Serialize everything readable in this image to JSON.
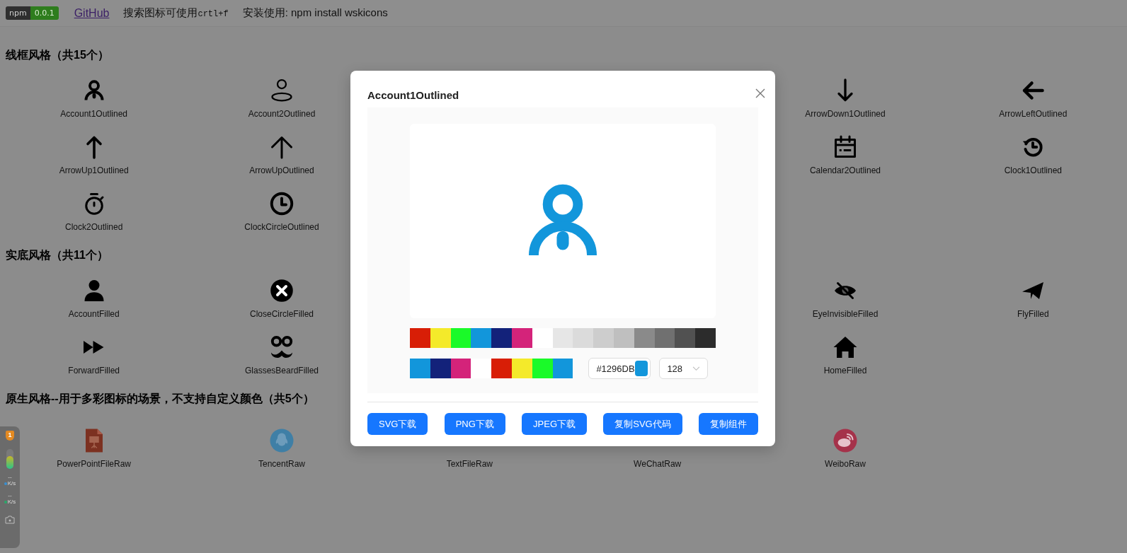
{
  "top_bar": {
    "badge": {
      "label": "npm",
      "version": "0.0.1"
    },
    "github_link": "GitHub",
    "search_hint": {
      "text": "搜索图标可使用",
      "shortcut": "crtl+f"
    },
    "install_hint": "安装使用: npm install wskicons"
  },
  "sections": [
    {
      "title": "线框风格（共15个）",
      "kind": "split",
      "left_items": [
        {
          "label": "Account1Outlined",
          "kind": "account1"
        },
        {
          "label": "Account2Outlined",
          "kind": "account2"
        },
        {
          "label": "ArrowUp1Outlined",
          "kind": "arrow-up1"
        },
        {
          "label": "ArrowUpOutlined",
          "kind": "arrow-up"
        },
        {
          "label": "Clock2Outlined",
          "kind": "stopwatch"
        },
        {
          "label": "ClockCircleOutlined",
          "kind": "clock-circle"
        }
      ],
      "right_items": [
        {
          "label": "ArrowDown1Outlined",
          "kind": "arrow-down"
        },
        {
          "label": "ArrowLeftOutlined",
          "kind": "arrow-left"
        },
        {
          "label": "Calendar2Outlined",
          "kind": "calendar"
        },
        {
          "label": "Clock1Outlined",
          "kind": "clock-rotate"
        }
      ]
    },
    {
      "title": "实底风格（共11个）",
      "kind": "split",
      "left_items": [
        {
          "label": "AccountFilled",
          "kind": "account-filled"
        },
        {
          "label": "CloseCircleFilled",
          "kind": "close-circle"
        },
        {
          "label": "ForwardFilled",
          "kind": "forward"
        },
        {
          "label": "GlassesBeardFilled",
          "kind": "glasses-beard"
        }
      ],
      "right_items": [
        {
          "label": "EyeInvisibleFilled",
          "kind": "eye-invisible"
        },
        {
          "label": "FlyFilled",
          "kind": "fly"
        },
        {
          "label": "HomeFilled",
          "kind": "home"
        }
      ]
    },
    {
      "title": "原生风格--用于多彩图标的场景，不支持自定义颜色（共5个）",
      "kind": "full",
      "items": [
        {
          "label": "PowerPointFileRaw",
          "kind": "powerpoint"
        },
        {
          "label": "TencentRaw",
          "kind": "tencent"
        },
        {
          "label": "TextFileRaw",
          "kind": "covered"
        },
        {
          "label": "WeChatRaw",
          "kind": "covered"
        },
        {
          "label": "WeiboRaw",
          "kind": "weibo"
        }
      ]
    }
  ],
  "modal": {
    "title": "Account1Outlined",
    "preview": {
      "kind": "account1"
    },
    "palette_row_1": [
      {
        "color": "#d81e06"
      },
      {
        "color": "#f4ea2a"
      },
      {
        "color": "#1afa29"
      },
      {
        "color": "#1296db"
      },
      {
        "color": "#13227a"
      },
      {
        "color": "#d4237a"
      },
      {
        "color": "#ffffff"
      },
      {
        "color": "#e6e6e6"
      },
      {
        "color": "#dbdbdb"
      },
      {
        "color": "#cdcdcd"
      },
      {
        "color": "#bfbfbf"
      },
      {
        "color": "#8a8a8a"
      },
      {
        "color": "#707070"
      },
      {
        "color": "#515151"
      },
      {
        "color": "#2c2c2c"
      }
    ],
    "palette_row_2": [
      {
        "color": "#1296db"
      },
      {
        "color": "#13227a"
      },
      {
        "color": "#d4237a"
      },
      {
        "color": "#ffffff"
      },
      {
        "color": "#d81e06"
      },
      {
        "color": "#f4ea2a"
      },
      {
        "color": "#1afa29"
      },
      {
        "color": "#1296db"
      }
    ],
    "color_field": {
      "value": "#1296DB"
    },
    "size_select": {
      "value": "128"
    },
    "buttons": [
      "SVG下载",
      "PNG下载",
      "JPEG下载",
      "复制SVG代码",
      "复制组件"
    ]
  },
  "monitor": {
    "badge": "1",
    "upload": {
      "value": "--",
      "unit": "K/s"
    },
    "download": {
      "value": "--",
      "unit": "K/s"
    }
  }
}
